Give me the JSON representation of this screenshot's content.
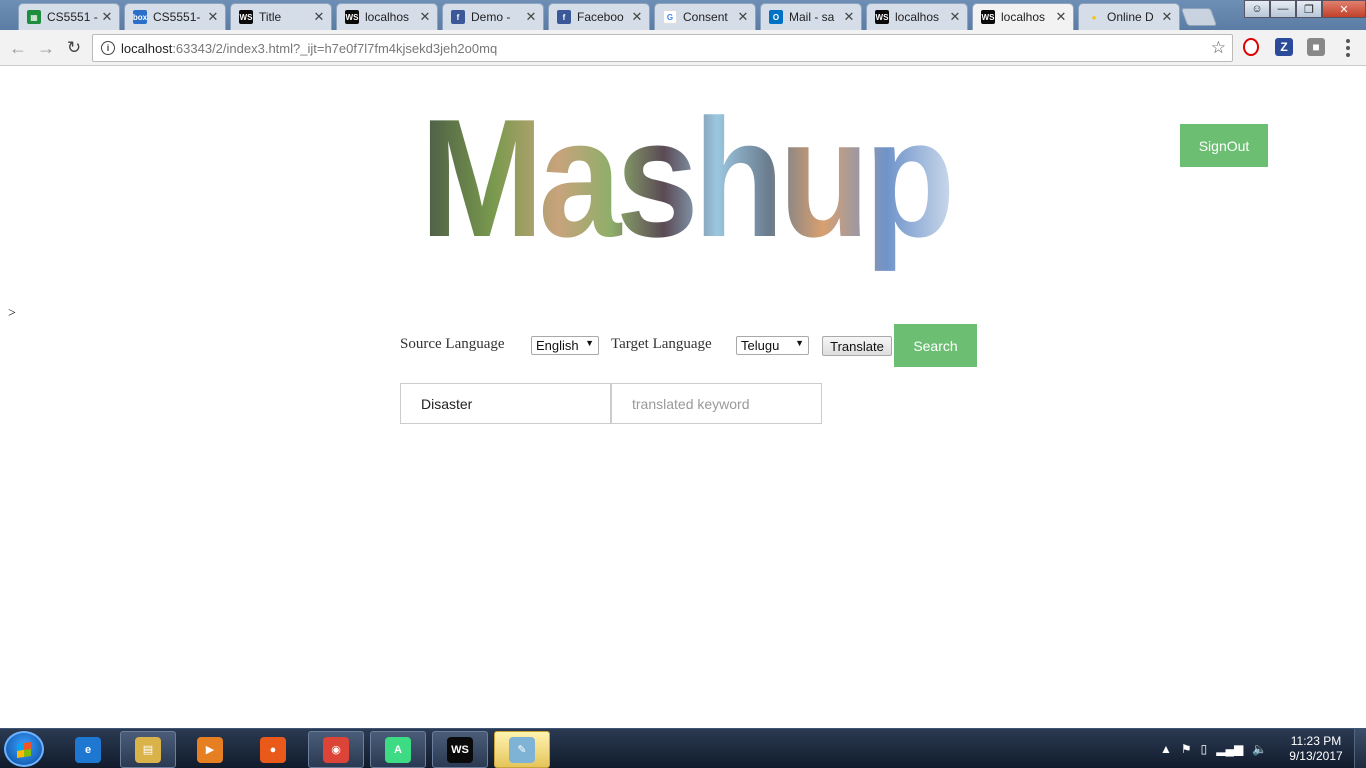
{
  "browser": {
    "tabs": [
      {
        "label": "CS5551 -",
        "icon": "sheets-icon",
        "color": "#1e8e3e"
      },
      {
        "label": "CS5551-",
        "icon": "box-icon",
        "color": "#2a6fc9"
      },
      {
        "label": "Title",
        "icon": "webstorm-icon",
        "color": "#0a0a0a"
      },
      {
        "label": "localhos",
        "icon": "webstorm-icon",
        "color": "#0a0a0a"
      },
      {
        "label": "Demo -",
        "icon": "facebook-icon",
        "color": "#3b5998"
      },
      {
        "label": "Faceboo",
        "icon": "facebook-icon",
        "color": "#3b5998"
      },
      {
        "label": "Consent",
        "icon": "google-icon",
        "color": "#ffffff"
      },
      {
        "label": "Mail - sa",
        "icon": "outlook-icon",
        "color": "#0072c6"
      },
      {
        "label": "localhos",
        "icon": "webstorm-icon",
        "color": "#0a0a0a"
      },
      {
        "label": "localhos",
        "icon": "webstorm-icon",
        "color": "#0a0a0a",
        "active": true
      },
      {
        "label": "Online D",
        "icon": "bulb-icon",
        "color": "#f4c20d"
      }
    ],
    "url": {
      "host": "localhost",
      "rest": ":63343/2/index3.html?_ijt=h7e0f7l7fm4kjsekd3jeh2o0mq"
    }
  },
  "page": {
    "logo_text": "Mashup",
    "signout_label": "SignOut",
    "stray_text": ">",
    "source_label": "Source Language",
    "source_value": "English",
    "target_label": "Target Language",
    "target_value": "Telugu",
    "translate_label": "Translate",
    "search_label": "Search",
    "keyword_value": "Disaster",
    "translated_placeholder": "translated keyword"
  },
  "taskbar": {
    "apps": [
      "internet-explorer-icon",
      "file-explorer-icon",
      "media-player-icon",
      "firefox-icon",
      "chrome-icon",
      "android-studio-icon",
      "webstorm-icon",
      "paint-icon"
    ],
    "time": "11:23 PM",
    "date": "9/13/2017"
  },
  "colors": {
    "accent_green": "#6cbf72"
  }
}
